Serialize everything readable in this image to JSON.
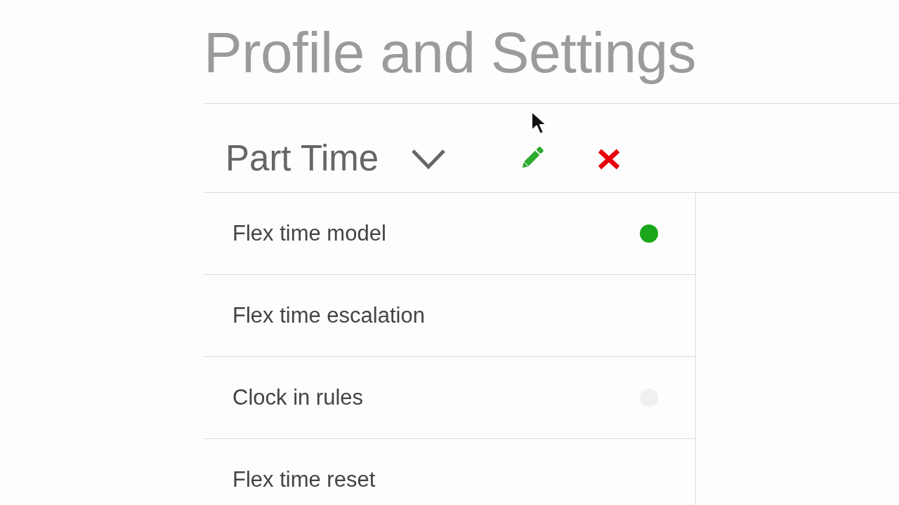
{
  "page": {
    "title": "Profile and Settings"
  },
  "profile": {
    "name": "Part Time"
  },
  "settings": [
    {
      "label": "Flex time model",
      "color": "#1aa81a"
    },
    {
      "label": "Flex time escalation"
    },
    {
      "label": "Clock in rules",
      "color": "#f1efef"
    },
    {
      "label": "Flex time reset"
    }
  ]
}
